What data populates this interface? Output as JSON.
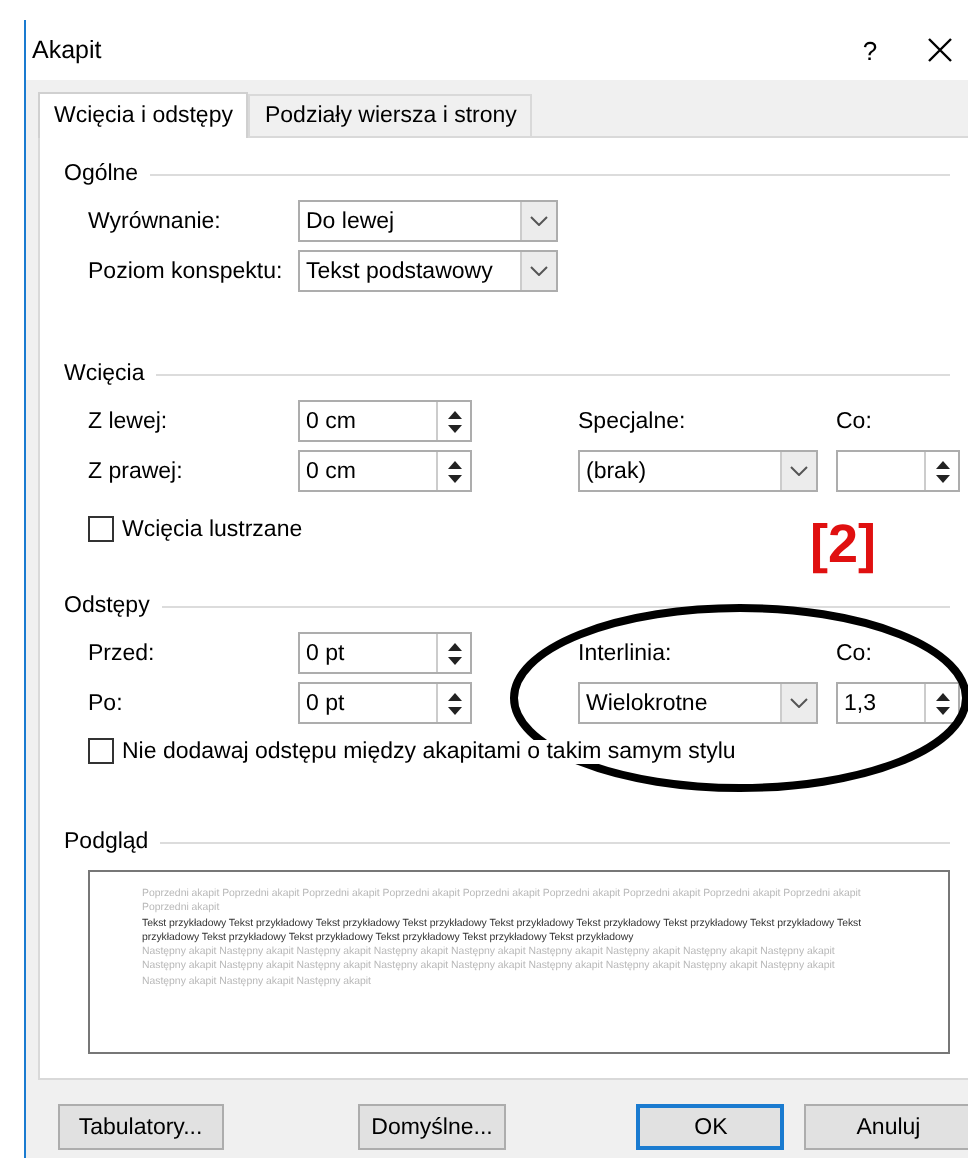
{
  "window": {
    "title": "Akapit",
    "help": "?"
  },
  "tabs": [
    {
      "label": "Wcięcia i odstępy",
      "selected": true
    },
    {
      "label": "Podziały wiersza i strony",
      "selected": false
    }
  ],
  "general": {
    "title": "Ogólne",
    "alignment": {
      "label": "Wyrównanie:",
      "value": "Do lewej"
    },
    "outline_level": {
      "label": "Poziom konspektu:",
      "value": "Tekst podstawowy"
    }
  },
  "indentation": {
    "title": "Wcięcia",
    "left": {
      "label": "Z lewej:",
      "value": "0 cm"
    },
    "right": {
      "label": "Z prawej:",
      "value": "0 cm"
    },
    "special": {
      "label": "Specjalne:",
      "value": "(brak)"
    },
    "by": {
      "label": "Co:"
    },
    "mirror": {
      "label": "Wcięcia lustrzane",
      "checked": false
    }
  },
  "spacing": {
    "title": "Odstępy",
    "before": {
      "label": "Przed:",
      "value": "0 pt"
    },
    "after": {
      "label": "Po:",
      "value": "0 pt"
    },
    "line_spacing": {
      "label": "Interlinia:",
      "value": "Wielokrotne"
    },
    "at": {
      "label": "Co:",
      "value": "1,3"
    },
    "dont_add": {
      "label": "Nie dodawaj odstępu między akapitami o takim samym stylu",
      "checked": false
    }
  },
  "preview": {
    "title": "Podgląd",
    "previous": "Poprzedni akapit Poprzedni akapit Poprzedni akapit Poprzedni akapit Poprzedni akapit Poprzedni akapit Poprzedni akapit Poprzedni akapit Poprzedni akapit Poprzedni akapit",
    "sample": "Tekst przykładowy Tekst przykładowy Tekst przykładowy Tekst przykładowy Tekst przykładowy Tekst przykładowy Tekst przykładowy Tekst przykładowy Tekst przykładowy Tekst przykładowy Tekst przykładowy Tekst przykładowy Tekst przykładowy Tekst przykładowy",
    "next": "Następny akapit Następny akapit Następny akapit Następny akapit Następny akapit Następny akapit Następny akapit Następny akapit Następny akapit Następny akapit Następny akapit Następny akapit Następny akapit Następny akapit Następny akapit Następny akapit Następny akapit Następny akapit Następny akapit Następny akapit Następny akapit"
  },
  "buttons": [
    {
      "label": "Tabulatory...",
      "default": false
    },
    {
      "label": "Domyślne...",
      "default": false
    },
    {
      "label": "OK",
      "default": true
    },
    {
      "label": "Anuluj",
      "default": false
    }
  ],
  "annotation": {
    "label": "[2]"
  }
}
